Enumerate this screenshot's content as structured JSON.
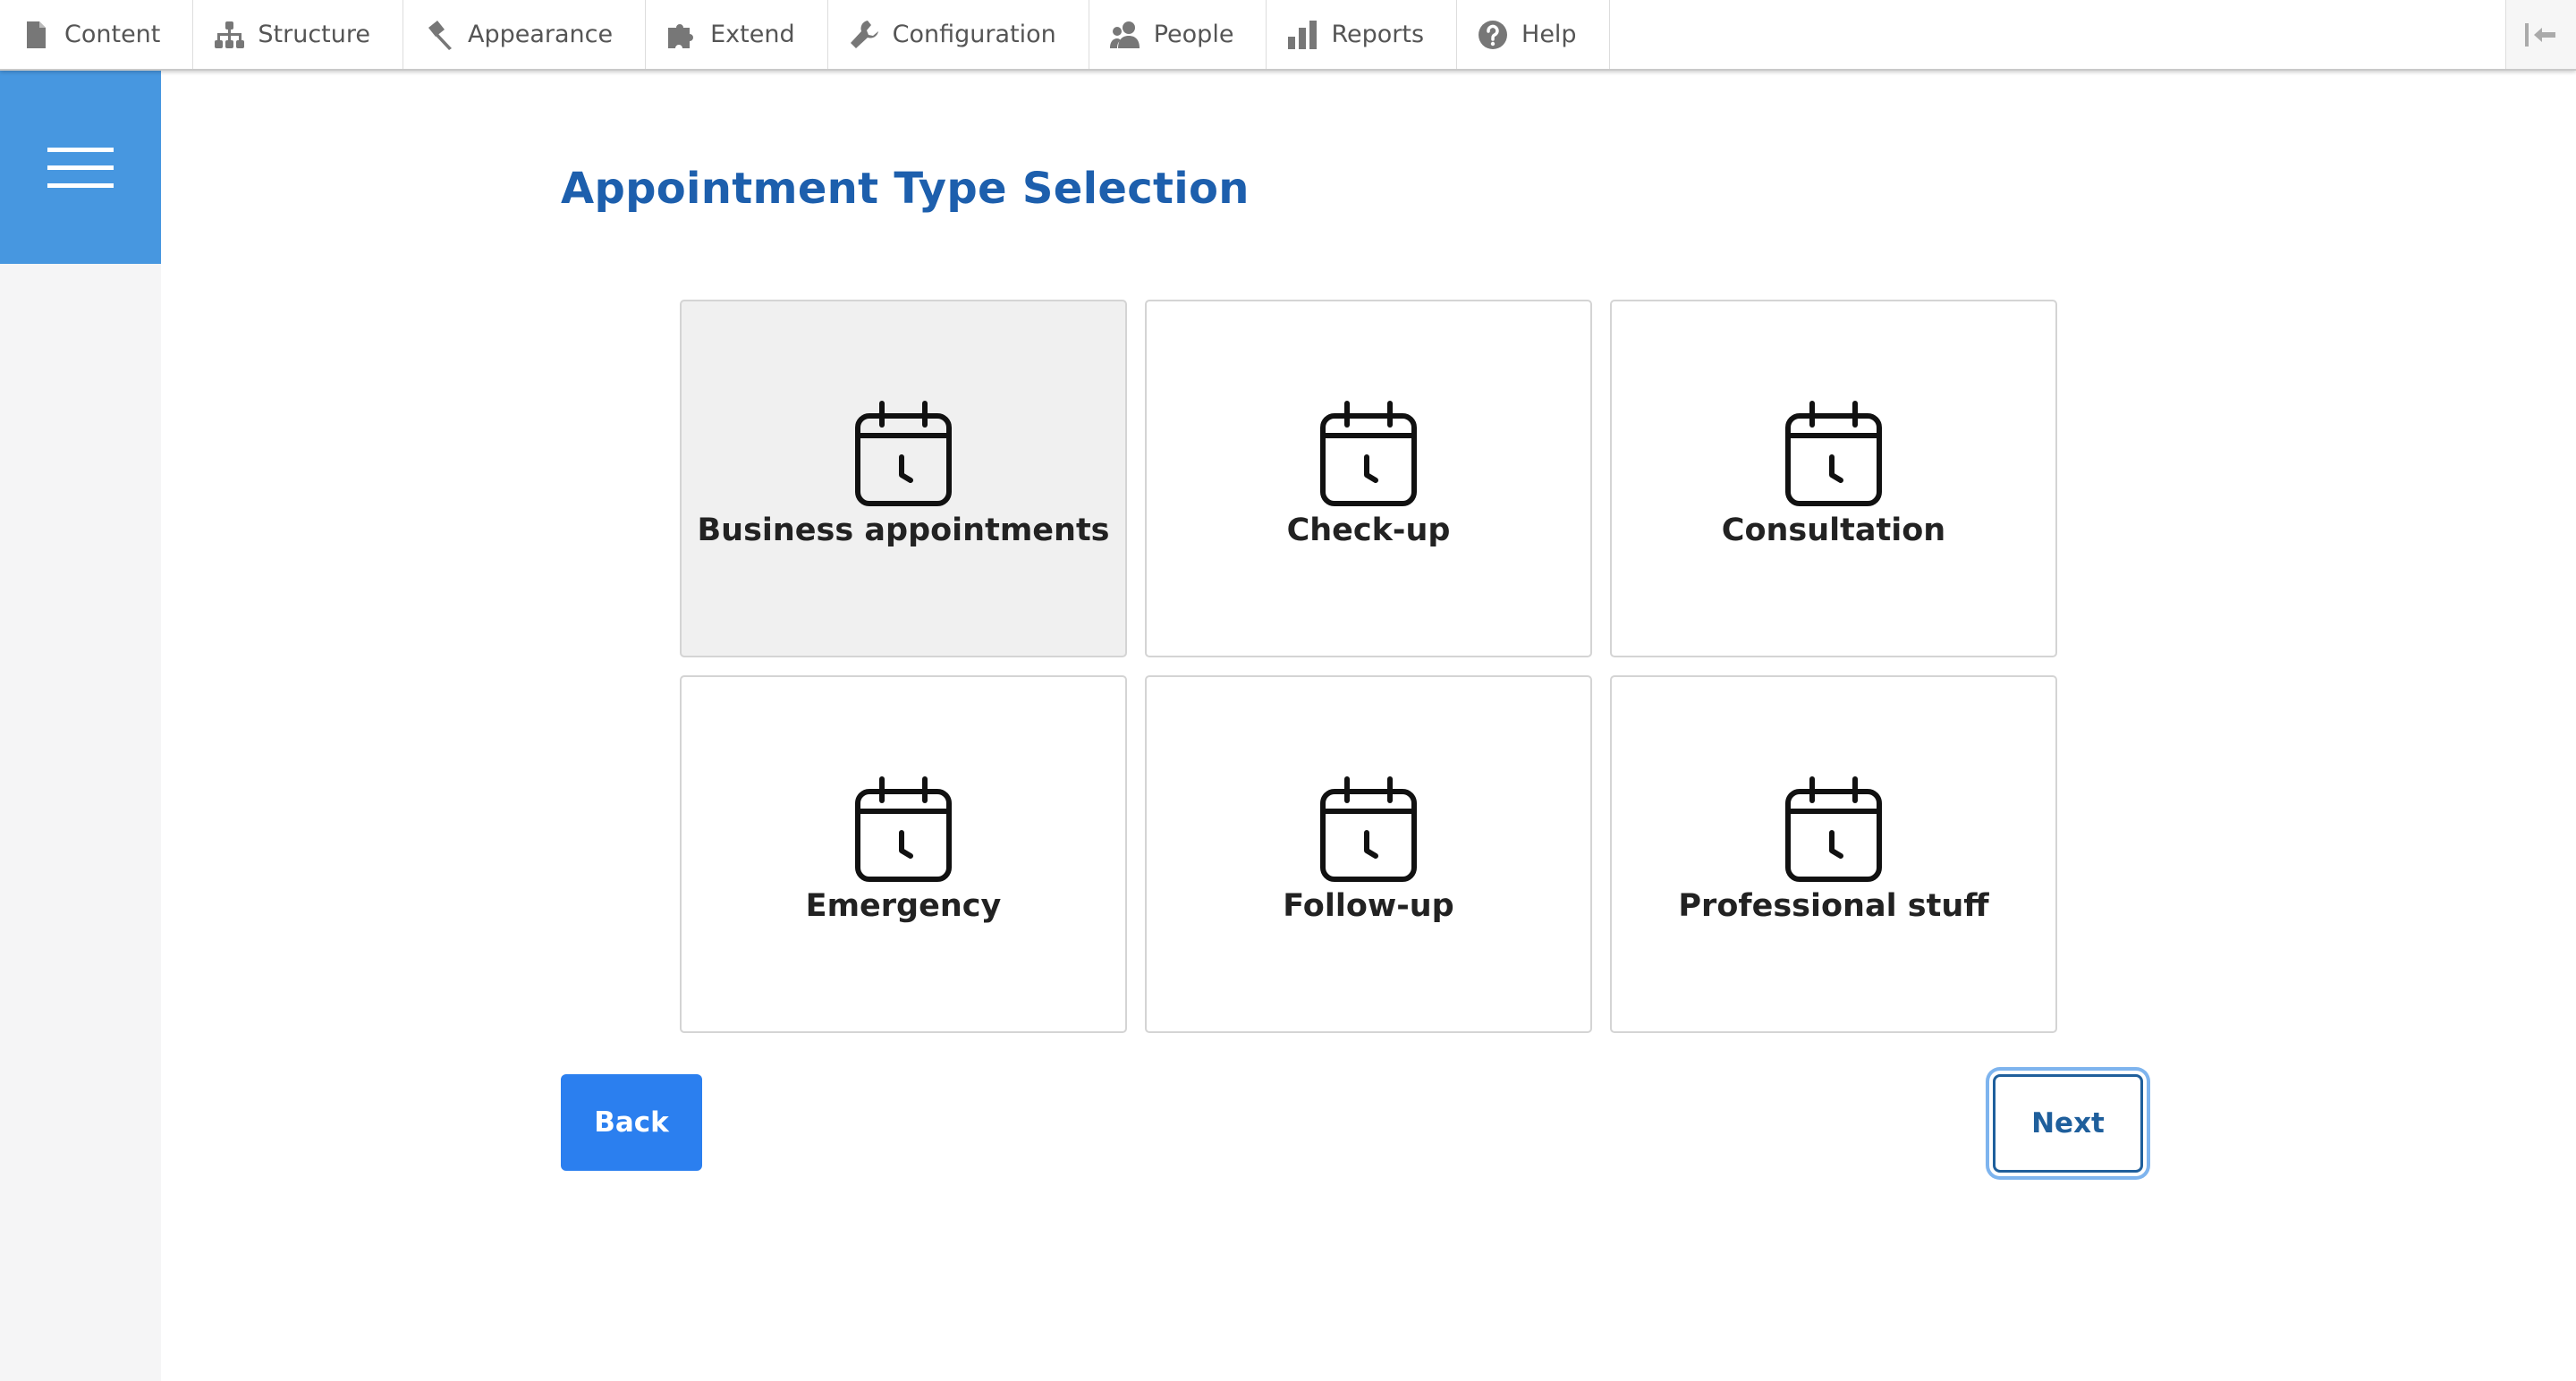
{
  "toolbar": {
    "items": [
      {
        "label": "Content",
        "icon": "file-icon"
      },
      {
        "label": "Structure",
        "icon": "sitemap-icon"
      },
      {
        "label": "Appearance",
        "icon": "paintbrush-icon"
      },
      {
        "label": "Extend",
        "icon": "puzzle-icon"
      },
      {
        "label": "Configuration",
        "icon": "wrench-icon"
      },
      {
        "label": "People",
        "icon": "people-icon"
      },
      {
        "label": "Reports",
        "icon": "bar-chart-icon"
      },
      {
        "label": "Help",
        "icon": "help-icon"
      }
    ],
    "collapse_icon": "collapse-toolbar-icon"
  },
  "sidebar": {
    "menu_icon": "hamburger-menu-icon",
    "accent_color": "#4797e0"
  },
  "page": {
    "title": "Appointment Type Selection",
    "title_color": "#1d5fad"
  },
  "appointment_types": [
    {
      "label": "Business appointments",
      "icon": "calendar-clock-icon",
      "selected": true
    },
    {
      "label": "Check-up",
      "icon": "calendar-clock-icon",
      "selected": false
    },
    {
      "label": "Consultation",
      "icon": "calendar-clock-icon",
      "selected": false
    },
    {
      "label": "Emergency",
      "icon": "calendar-clock-icon",
      "selected": false
    },
    {
      "label": "Follow-up",
      "icon": "calendar-clock-icon",
      "selected": false
    },
    {
      "label": "Professional stuff",
      "icon": "calendar-clock-icon",
      "selected": false
    }
  ],
  "actions": {
    "back_label": "Back",
    "next_label": "Next",
    "back_color": "#2b7fef",
    "next_color": "#1f5f9c"
  }
}
